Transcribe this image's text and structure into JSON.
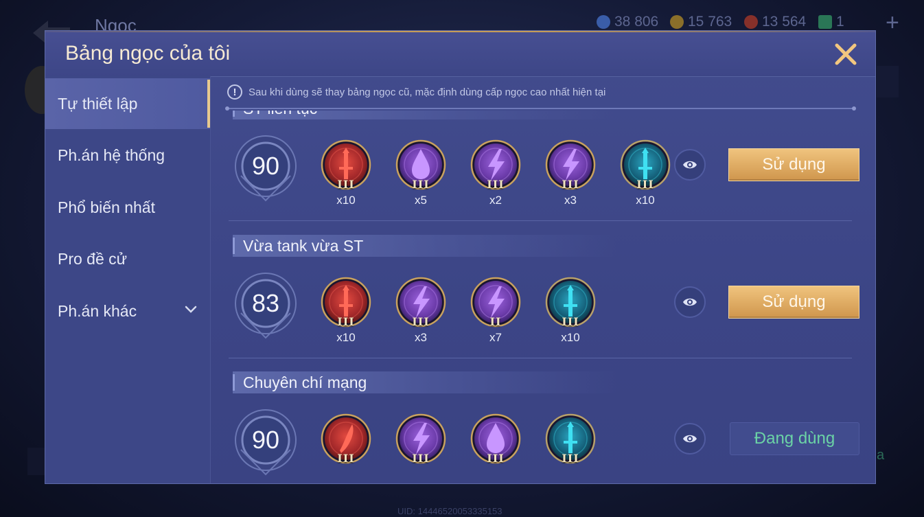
{
  "background": {
    "screen_title": "Ngọc",
    "currencies": [
      {
        "icon": "blue-gem-icon",
        "value": "38 806",
        "color": "#4e7bd6"
      },
      {
        "icon": "gold-coin-icon",
        "value": "15 763",
        "color": "#c9a035"
      },
      {
        "icon": "red-gem-icon",
        "value": "13 564",
        "color": "#c7463a"
      },
      {
        "icon": "green-card-icon",
        "value": "1",
        "color": "#3fb07a"
      }
    ],
    "uid": "UID: 14446520053335153",
    "right_fragment": "a"
  },
  "modal": {
    "title": "Bảng ngọc của tôi",
    "notice": "Sau khi dùng sẽ thay bảng ngọc cũ, mặc định dùng cấp ngọc cao nhất hiện tại"
  },
  "sidebar": {
    "items": [
      {
        "label": "Tự thiết lập",
        "active": true
      },
      {
        "label": "Ph.án hệ thống"
      },
      {
        "label": "Phổ biến nhất"
      },
      {
        "label": "Pro đề cử"
      },
      {
        "label": "Ph.án khác",
        "has_dropdown": true
      }
    ]
  },
  "pages": [
    {
      "name": "ST liên tục",
      "level": "90",
      "gems": [
        {
          "color": "red",
          "symbol": "sword",
          "tier": "III",
          "count": "x10"
        },
        {
          "color": "purple",
          "symbol": "drop",
          "tier": "III",
          "count": "x5"
        },
        {
          "color": "purple",
          "symbol": "bolt",
          "tier": "III",
          "count": "x2"
        },
        {
          "color": "purple",
          "symbol": "bolt",
          "tier": "III",
          "count": "x3"
        },
        {
          "color": "teal",
          "symbol": "sword",
          "tier": "III",
          "count": "x10"
        }
      ],
      "button": "Sử dụng",
      "button_state": "use"
    },
    {
      "name": "Vừa tank vừa ST",
      "level": "83",
      "gems": [
        {
          "color": "red",
          "symbol": "sword",
          "tier": "III",
          "count": "x10"
        },
        {
          "color": "purple",
          "symbol": "bolt",
          "tier": "III",
          "count": "x3"
        },
        {
          "color": "purple",
          "symbol": "bolt",
          "tier": "II",
          "count": "x7"
        },
        {
          "color": "teal",
          "symbol": "sword",
          "tier": "III",
          "count": "x10"
        }
      ],
      "button": "Sử dụng",
      "button_state": "use"
    },
    {
      "name": "Chuyên chí mạng",
      "level": "90",
      "gems": [
        {
          "color": "red",
          "symbol": "blade",
          "tier": "III"
        },
        {
          "color": "purple",
          "symbol": "bolt",
          "tier": "III"
        },
        {
          "color": "purple",
          "symbol": "drop",
          "tier": "III"
        },
        {
          "color": "teal",
          "symbol": "sword",
          "tier": "III"
        }
      ],
      "button": "Đang dùng",
      "button_state": "current"
    }
  ]
}
